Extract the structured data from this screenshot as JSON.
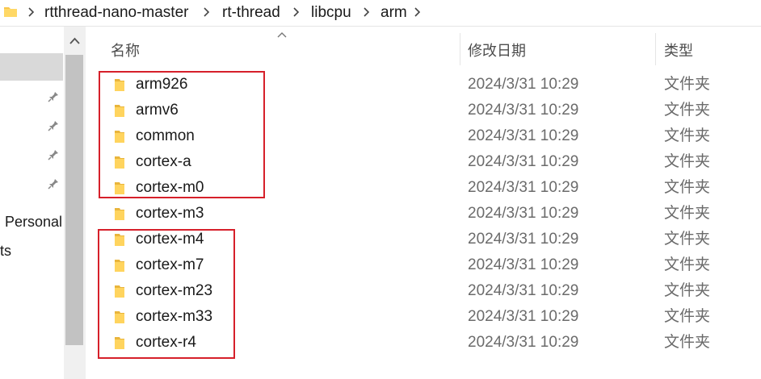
{
  "address_bar": {
    "folder_icon": "folder-icon",
    "separator_icon": "chevron-right-icon",
    "crumbs": [
      "rtthread-nano-master",
      "rt-thread",
      "libcpu",
      "arm"
    ]
  },
  "nav_pane": {
    "pin_icon": "pin-icon",
    "items": [
      "Personal",
      "ts"
    ]
  },
  "columns": {
    "name": "名称",
    "date": "修改日期",
    "type": "类型"
  },
  "files": [
    {
      "name": "arm926",
      "date": "2024/3/31 10:29",
      "type": "文件夹"
    },
    {
      "name": "armv6",
      "date": "2024/3/31 10:29",
      "type": "文件夹"
    },
    {
      "name": "common",
      "date": "2024/3/31 10:29",
      "type": "文件夹"
    },
    {
      "name": "cortex-a",
      "date": "2024/3/31 10:29",
      "type": "文件夹"
    },
    {
      "name": "cortex-m0",
      "date": "2024/3/31 10:29",
      "type": "文件夹"
    },
    {
      "name": "cortex-m3",
      "date": "2024/3/31 10:29",
      "type": "文件夹"
    },
    {
      "name": "cortex-m4",
      "date": "2024/3/31 10:29",
      "type": "文件夹"
    },
    {
      "name": "cortex-m7",
      "date": "2024/3/31 10:29",
      "type": "文件夹"
    },
    {
      "name": "cortex-m23",
      "date": "2024/3/31 10:29",
      "type": "文件夹"
    },
    {
      "name": "cortex-m33",
      "date": "2024/3/31 10:29",
      "type": "文件夹"
    },
    {
      "name": "cortex-r4",
      "date": "2024/3/31 10:29",
      "type": "文件夹"
    }
  ],
  "colors": {
    "highlight_box": "#d6202a",
    "folder_yellow": "#f8c64c"
  }
}
